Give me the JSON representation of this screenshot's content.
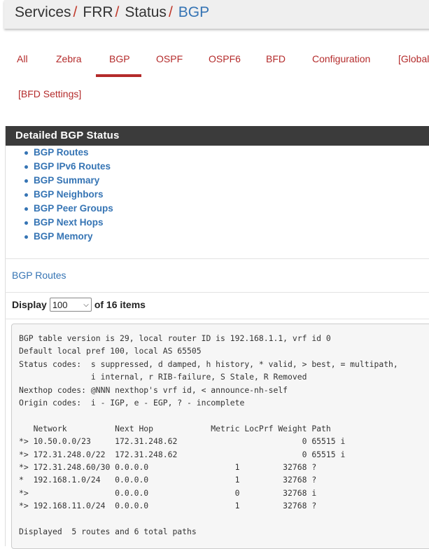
{
  "breadcrumb": {
    "items": [
      "Services",
      "FRR",
      "Status"
    ],
    "separator": "/",
    "current": "BGP"
  },
  "tabs": {
    "all": "All",
    "zebra": "Zebra",
    "bgp": "BGP",
    "ospf": "OSPF",
    "ospf6": "OSPF6",
    "bfd": "BFD",
    "configuration": "Configuration",
    "global": "[Global",
    "bfd_settings": "[BFD Settings]"
  },
  "panel": {
    "title": "Detailed BGP Status",
    "links": [
      "BGP Routes",
      "BGP IPv6 Routes",
      "BGP Summary",
      "BGP Neighbors",
      "BGP Peer Groups",
      "BGP Next Hops",
      "BGP Memory"
    ]
  },
  "section": {
    "title": "BGP Routes",
    "display_label": "Display",
    "display_value": "100",
    "display_suffix": "of 16 items"
  },
  "output": {
    "lines": [
      "BGP table version is 29, local router ID is 192.168.1.1, vrf id 0",
      "Default local pref 100, local AS 65505",
      "Status codes:  s suppressed, d damped, h history, * valid, > best, = multipath,",
      "               i internal, r RIB-failure, S Stale, R Removed",
      "Nexthop codes: @NNN nexthop's vrf id, < announce-nh-self",
      "Origin codes:  i - IGP, e - EGP, ? - incomplete",
      "",
      "   Network          Next Hop            Metric LocPrf Weight Path",
      "*> 10.50.0.0/23     172.31.248.62                          0 65515 i",
      "*> 172.31.248.0/22  172.31.248.62                          0 65515 i",
      "*> 172.31.248.60/30 0.0.0.0                  1         32768 ?",
      "*  192.168.1.0/24   0.0.0.0                  1         32768 ?",
      "*>                  0.0.0.0                  0         32768 i",
      "*> 192.168.11.0/24  0.0.0.0                  1         32768 ?",
      "",
      "Displayed  5 routes and 6 total paths"
    ]
  },
  "colors": {
    "link_blue": "#3574b4",
    "tab_red": "#b42b2b",
    "header_dark": "#3b3b3b"
  }
}
